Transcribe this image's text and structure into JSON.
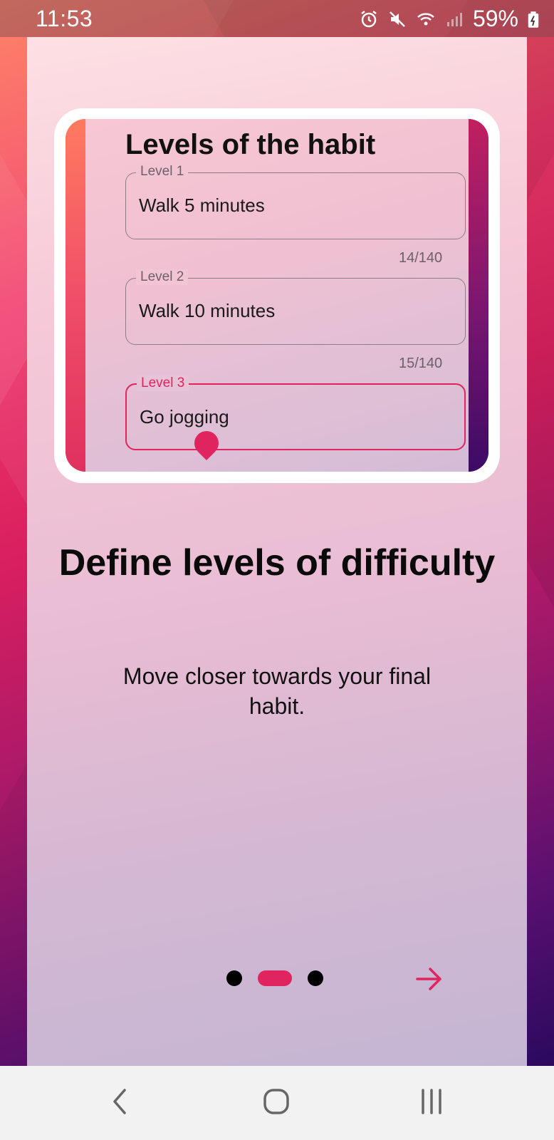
{
  "status_bar": {
    "time": "11:53",
    "battery": "59%",
    "icons": [
      "alarm-icon",
      "mute-icon",
      "wifi-icon",
      "signal-icon",
      "battery-icon"
    ]
  },
  "card": {
    "title": "Levels of the habit",
    "levels": [
      {
        "label": "Level 1",
        "value": "Walk 5 minutes",
        "counter": "14/140"
      },
      {
        "label": "Level 2",
        "value": "Walk 10 minutes",
        "counter": "15/140"
      },
      {
        "label": "Level 3",
        "value": "Go jogging"
      }
    ]
  },
  "headline": "Define levels of difficulty",
  "subtext": "Move closer towards your final habit.",
  "pager": {
    "total": 3,
    "current": 2
  },
  "colors": {
    "accent": "#e0245f",
    "text": "#0a0a0a"
  },
  "nav": {
    "back": "back-icon",
    "home": "home-icon",
    "recents": "recents-icon"
  }
}
